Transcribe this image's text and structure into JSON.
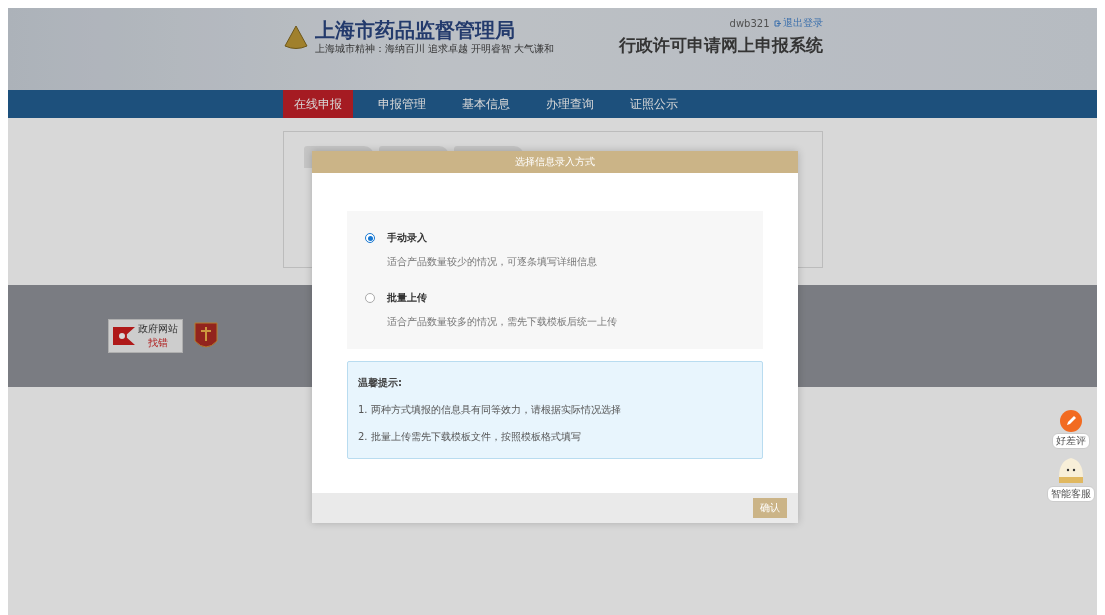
{
  "header": {
    "title": "上海市药品监督管理局",
    "slogan": "上海城市精神：海纳百川  追求卓越  开明睿智  大气谦和",
    "user": "dwb321",
    "logout": "退出登录",
    "system_title": "行政许可申请网上申报系统"
  },
  "nav": [
    {
      "label": "在线申报",
      "selected": true
    },
    {
      "label": "申报管理",
      "selected": false
    },
    {
      "label": "基本信息",
      "selected": false
    },
    {
      "label": "办理查询",
      "selected": false
    },
    {
      "label": "证照公示",
      "selected": false
    }
  ],
  "footer": {
    "badge_title": "政府网站",
    "badge_sub": "找错"
  },
  "side": [
    {
      "kind": "rate",
      "label": "好差评"
    },
    {
      "kind": "service",
      "label": "智能客服"
    }
  ],
  "modal": {
    "title": "选择信息录入方式",
    "options": [
      {
        "label": "手动录入",
        "desc": "适合产品数量较少的情况，可逐条填写详细信息",
        "selected": true
      },
      {
        "label": "批量上传",
        "desc": "适合产品数量较多的情况，需先下载模板后统一上传",
        "selected": false
      }
    ],
    "tips": {
      "title": "温馨提示:",
      "items": [
        "1. 两种方式填报的信息具有同等效力，请根据实际情况选择",
        "2. 批量上传需先下载模板文件，按照模板格式填写"
      ]
    },
    "confirm": "确认"
  }
}
